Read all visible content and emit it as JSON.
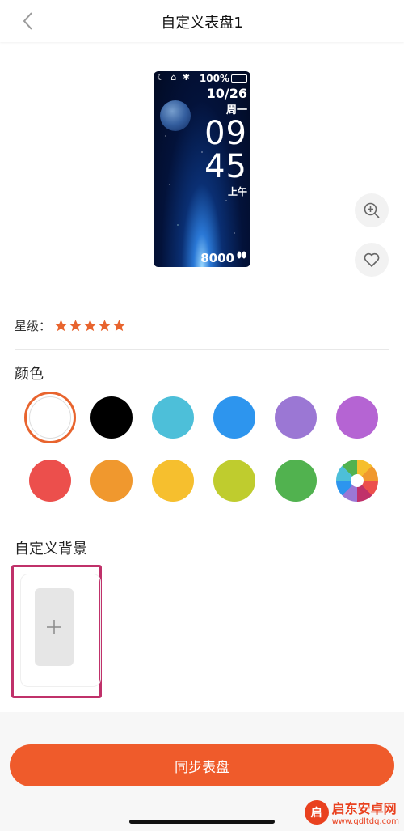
{
  "header": {
    "title": "自定义表盘1",
    "back_icon": "chevron-left-icon"
  },
  "preview": {
    "status_icons": "☾ ⌂ ✱",
    "battery_text": "100%",
    "date": "10/26",
    "weekday": "周一",
    "hour": "09",
    "minute": "45",
    "ampm": "上午",
    "steps": "8000",
    "steps_icon": "footprints-icon"
  },
  "side_actions": {
    "zoom_icon": "zoom-in-icon",
    "favorite_icon": "heart-icon"
  },
  "rating": {
    "label": "星级：",
    "stars": 5,
    "star_color": "#e8642e"
  },
  "colors": {
    "title": "颜色",
    "swatches": [
      "#ffffff",
      "#000000",
      "#4dbfd9",
      "#2d95ee",
      "#9b77d4",
      "#b564d3",
      "#ec4f4c",
      "#f0982e",
      "#f6bf2e",
      "#bfcc2e",
      "#51b24f",
      "multicolor"
    ],
    "selected_index": 0
  },
  "custom_background": {
    "title": "自定义背景",
    "add_icon": "plus-icon"
  },
  "footer": {
    "sync_label": "同步表盘",
    "accent": "#ef5b2b"
  },
  "watermark": {
    "name": "启东安卓网",
    "url": "www.qdltdq.com"
  }
}
